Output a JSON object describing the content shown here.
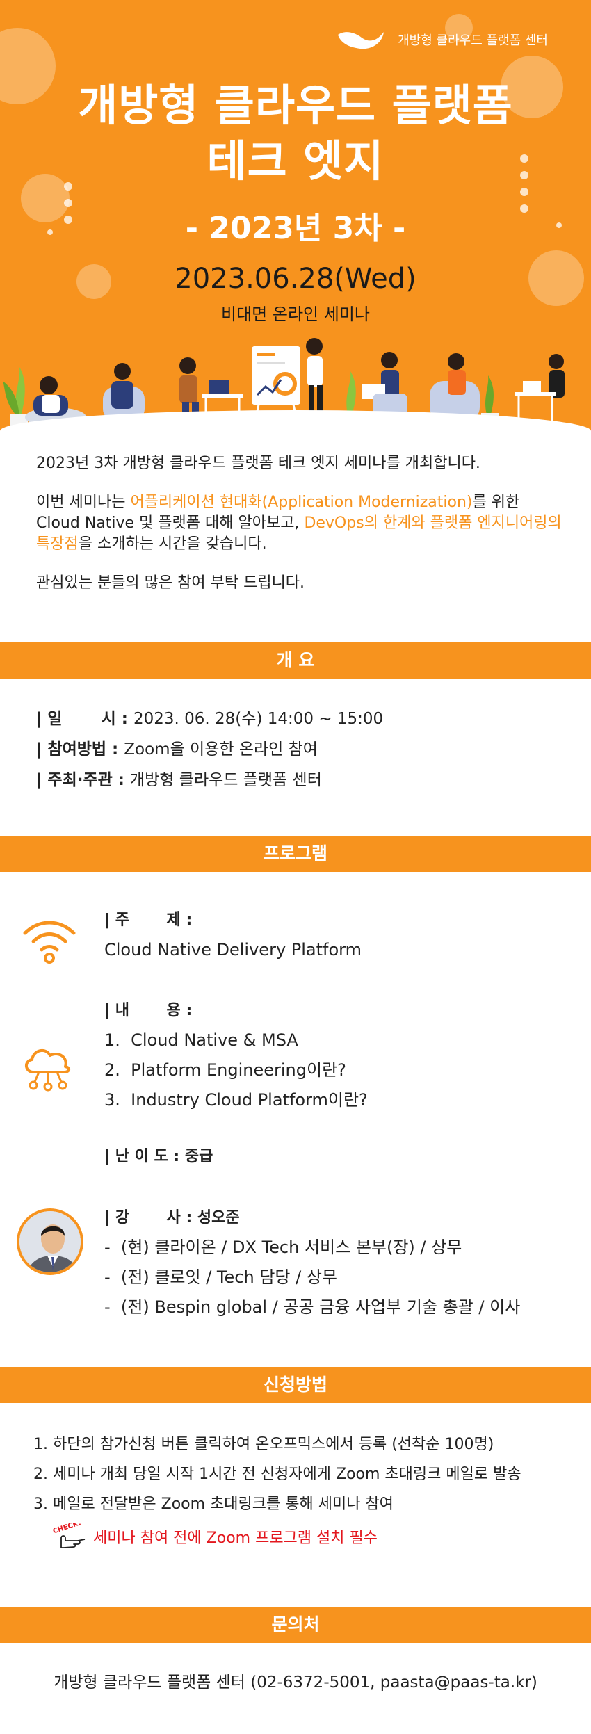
{
  "hero": {
    "brand": "개방형 클라우드 플랫폼 센터",
    "title_line1": "개방형 클라우드 플랫폼",
    "title_line2": "테크 엣지",
    "round": "- 2023년 3차 -",
    "date": "2023.06.28(Wed)",
    "subtitle": "비대면 온라인 세미나"
  },
  "intro": {
    "p1": "2023년 3차 개방형 클라우드 플랫폼 테크 엣지 세미나를 개최합니다.",
    "p2_a": "이번 세미나는 ",
    "p2_hl1": "어플리케이션 현대화(Application Modernization)",
    "p2_b": "를 위한 Cloud Native 및 플랫폼 대해 알아보고, ",
    "p2_hl2": "DevOps의 한계와 플랫폼 엔지니어링의 특장점",
    "p2_c": "을 소개하는 시간을 갖습니다.",
    "p3": "관심있는 분들의 많은 참여 부탁 드립니다."
  },
  "overview": {
    "heading": "개    요",
    "rows": [
      {
        "label": "| 일       시 : ",
        "value": "2023. 06. 28(수) 14:00 ~ 15:00"
      },
      {
        "label": "| 참여방법 : ",
        "value": "Zoom을 이용한 온라인 참여"
      },
      {
        "label": "| 주최·주관 : ",
        "value": "개방형 클라우드 플랫폼 센터"
      }
    ]
  },
  "program": {
    "heading": "프로그램",
    "topic_label": "| 주       제 :",
    "topic": "Cloud Native Delivery Platform",
    "content_label": "| 내       용 :",
    "contents": [
      "1.  Cloud Native & MSA",
      "2.  Platform Engineering이란?",
      "3.  Industry Cloud Platform이란?"
    ],
    "level": "| 난 이 도 : 중급",
    "speaker": "| 강       사 : 성오준",
    "speaker_career": [
      "-  (현) 클라이온 / DX Tech 서비스 본부(장) / 상무",
      "-  (전) 클로잇 / Tech 담당 / 상무",
      "-  (전) Bespin global / 공공 금융 사업부 기술 총괄 / 이사"
    ]
  },
  "apply": {
    "heading": "신청방법",
    "steps": [
      "1. 하단의 참가신청 버튼 클릭하여 온오프믹스에서 등록 (선착순 100명)",
      "2. 세미나 개최 당일 시작 1시간 전 신청자에게 Zoom 초대링크 메일로 발송",
      "3. 메일로 전달받은 Zoom 초대링크를 통해 세미나 참여"
    ],
    "check_badge": "CHECK!",
    "note": "세미나 참여 전에 Zoom 프로그램 설치 필수"
  },
  "contact": {
    "heading": "문의처",
    "text": "개방형 클라우드 플랫폼 센터 (02-6372-5001, paasta@paas-ta.kr)"
  },
  "colors": {
    "brand_orange": "#f7931e",
    "note_red": "#e3171e"
  }
}
